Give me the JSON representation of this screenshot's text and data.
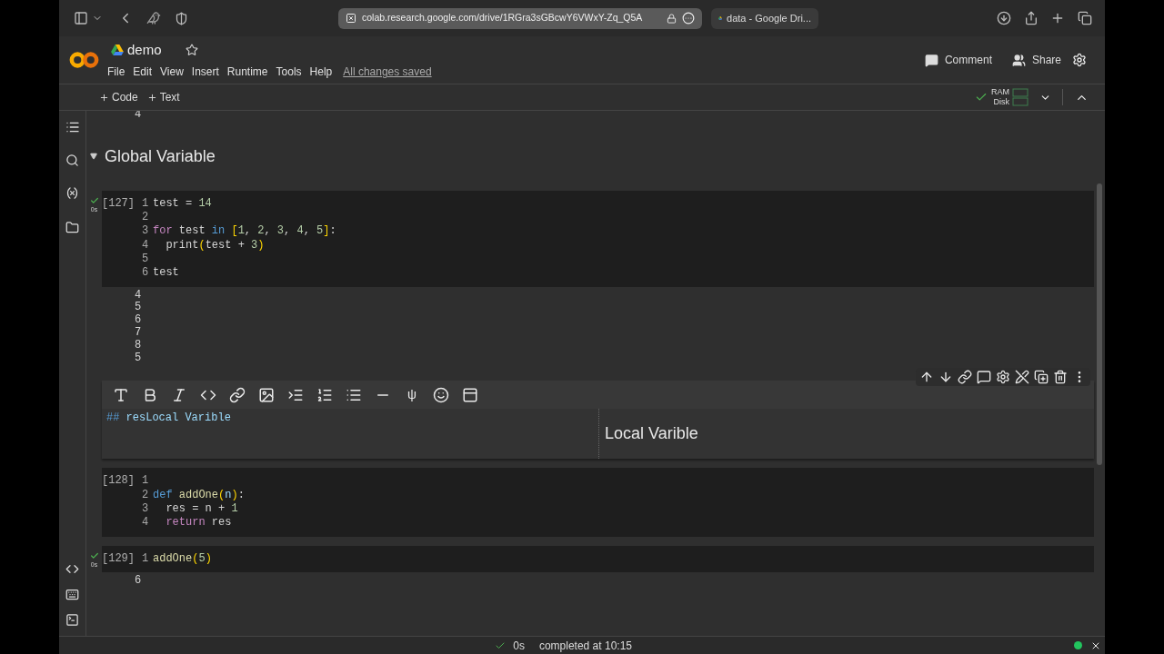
{
  "browser": {
    "url": "colab.research.google.com/drive/1RGra3sGBcwY6VWxY-Zq_Q5A",
    "tab": "data - Google Dri..."
  },
  "header": {
    "title": "demo",
    "menu": [
      "File",
      "Edit",
      "View",
      "Insert",
      "Runtime",
      "Tools",
      "Help"
    ],
    "save_status": "All changes saved",
    "actions": [
      {
        "kind": "comment",
        "label": "Comment"
      },
      {
        "kind": "share",
        "label": "Share"
      }
    ]
  },
  "toolbar": {
    "add": [
      "Code",
      "Text"
    ],
    "connected": true,
    "resources": [
      "RAM",
      "Disk"
    ]
  },
  "cells": [
    {
      "kind": "output",
      "lines": [
        "4"
      ]
    },
    {
      "kind": "section",
      "title": "Global Variable",
      "expanded": true
    },
    {
      "kind": "code",
      "count": "[127]",
      "ran": true,
      "time": "0s",
      "lines": [
        {
          "n": "1",
          "tokens": [
            {
              "text": "test = ",
              "kind": "plain"
            },
            {
              "text": "14",
              "kind": "number"
            }
          ]
        },
        {
          "n": "2"
        },
        {
          "n": "3",
          "tokens": [
            {
              "text": "for",
              "kind": "control"
            },
            {
              "text": " test ",
              "kind": "plain"
            },
            {
              "text": "in ",
              "kind": "keyword"
            },
            {
              "text": "[",
              "kind": "bracket"
            },
            {
              "text": "1",
              "kind": "number"
            },
            {
              "text": ", ",
              "kind": "plain"
            },
            {
              "text": "2",
              "kind": "number"
            },
            {
              "text": ", ",
              "kind": "plain"
            },
            {
              "text": "3",
              "kind": "number"
            },
            {
              "text": ", ",
              "kind": "plain"
            },
            {
              "text": "4",
              "kind": "number"
            },
            {
              "text": ", ",
              "kind": "plain"
            },
            {
              "text": "5",
              "kind": "number"
            },
            {
              "text": "]",
              "kind": "bracket"
            },
            {
              "text": ":",
              "kind": "plain"
            }
          ]
        },
        {
          "n": "4",
          "tokens": [
            {
              "text": "  print",
              "kind": "plain"
            },
            {
              "text": "(",
              "kind": "bracket"
            },
            {
              "text": "test + ",
              "kind": "plain"
            },
            {
              "text": "3",
              "kind": "number"
            },
            {
              "text": ")",
              "kind": "bracket"
            }
          ]
        },
        {
          "n": "5"
        },
        {
          "n": "6",
          "tokens": [
            {
              "text": "test",
              "kind": "plain"
            }
          ]
        }
      ]
    },
    {
      "kind": "output",
      "lines": [
        "4",
        "5",
        "6",
        "7",
        "8",
        "5"
      ]
    },
    {
      "kind": "text_editor",
      "source": [
        {
          "text": "## ",
          "kind": "keyword"
        },
        {
          "text": "resLocal Varible",
          "kind": "param"
        }
      ],
      "preview": "Local Varible",
      "format_tools": [
        {
          "kind": "heading"
        },
        {
          "kind": "bold"
        },
        {
          "kind": "italic"
        },
        {
          "kind": "code"
        },
        {
          "kind": "link"
        },
        {
          "kind": "image"
        },
        {
          "kind": "indent"
        },
        {
          "kind": "numbered"
        },
        {
          "kind": "bulleted"
        },
        {
          "kind": "rule"
        },
        {
          "kind": "math",
          "label": "ψ"
        },
        {
          "kind": "emoji"
        },
        {
          "kind": "layout"
        }
      ],
      "cell_tools": [
        {
          "kind": "up"
        },
        {
          "kind": "down"
        },
        {
          "kind": "link"
        },
        {
          "kind": "comment"
        },
        {
          "kind": "settings"
        },
        {
          "kind": "edit"
        },
        {
          "kind": "mirror"
        },
        {
          "kind": "delete"
        },
        {
          "kind": "more"
        }
      ]
    },
    {
      "kind": "code",
      "count": "[128]",
      "ran": false,
      "lines": [
        {
          "n": "1"
        },
        {
          "n": "2",
          "tokens": [
            {
              "text": "def ",
              "kind": "keyword"
            },
            {
              "text": "addOne",
              "kind": "function"
            },
            {
              "text": "(",
              "kind": "bracket"
            },
            {
              "text": "n",
              "kind": "param"
            },
            {
              "text": ")",
              "kind": "bracket"
            },
            {
              "text": ":",
              "kind": "plain"
            }
          ]
        },
        {
          "n": "3",
          "tokens": [
            {
              "text": "  res = n + ",
              "kind": "plain"
            },
            {
              "text": "1",
              "kind": "number"
            }
          ]
        },
        {
          "n": "4",
          "tokens": [
            {
              "text": "  return",
              "kind": "control"
            },
            {
              "text": " res",
              "kind": "plain"
            }
          ]
        }
      ]
    },
    {
      "kind": "code",
      "count": "[129]",
      "ran": true,
      "time": "0s",
      "lines": [
        {
          "n": "1",
          "tokens": [
            {
              "text": "addOne",
              "kind": "function"
            },
            {
              "text": "(",
              "kind": "bracket"
            },
            {
              "text": "5",
              "kind": "number"
            },
            {
              "text": ")",
              "kind": "bracket"
            }
          ]
        }
      ]
    },
    {
      "kind": "output",
      "lines": [
        "6"
      ]
    }
  ],
  "status_bar": {
    "ok": true,
    "duration": "0s",
    "message": "completed at 10:15",
    "connected": true
  }
}
